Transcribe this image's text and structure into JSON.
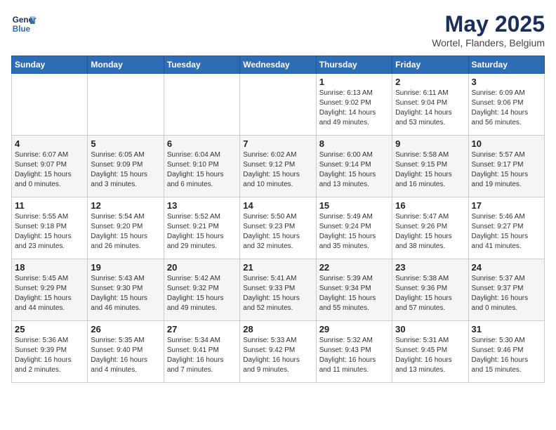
{
  "logo": {
    "line1": "General",
    "line2": "Blue"
  },
  "title": "May 2025",
  "location": "Wortel, Flanders, Belgium",
  "days_header": [
    "Sunday",
    "Monday",
    "Tuesday",
    "Wednesday",
    "Thursday",
    "Friday",
    "Saturday"
  ],
  "weeks": [
    [
      {
        "day": "",
        "info": ""
      },
      {
        "day": "",
        "info": ""
      },
      {
        "day": "",
        "info": ""
      },
      {
        "day": "",
        "info": ""
      },
      {
        "day": "1",
        "info": "Sunrise: 6:13 AM\nSunset: 9:02 PM\nDaylight: 14 hours\nand 49 minutes."
      },
      {
        "day": "2",
        "info": "Sunrise: 6:11 AM\nSunset: 9:04 PM\nDaylight: 14 hours\nand 53 minutes."
      },
      {
        "day": "3",
        "info": "Sunrise: 6:09 AM\nSunset: 9:06 PM\nDaylight: 14 hours\nand 56 minutes."
      }
    ],
    [
      {
        "day": "4",
        "info": "Sunrise: 6:07 AM\nSunset: 9:07 PM\nDaylight: 15 hours\nand 0 minutes."
      },
      {
        "day": "5",
        "info": "Sunrise: 6:05 AM\nSunset: 9:09 PM\nDaylight: 15 hours\nand 3 minutes."
      },
      {
        "day": "6",
        "info": "Sunrise: 6:04 AM\nSunset: 9:10 PM\nDaylight: 15 hours\nand 6 minutes."
      },
      {
        "day": "7",
        "info": "Sunrise: 6:02 AM\nSunset: 9:12 PM\nDaylight: 15 hours\nand 10 minutes."
      },
      {
        "day": "8",
        "info": "Sunrise: 6:00 AM\nSunset: 9:14 PM\nDaylight: 15 hours\nand 13 minutes."
      },
      {
        "day": "9",
        "info": "Sunrise: 5:58 AM\nSunset: 9:15 PM\nDaylight: 15 hours\nand 16 minutes."
      },
      {
        "day": "10",
        "info": "Sunrise: 5:57 AM\nSunset: 9:17 PM\nDaylight: 15 hours\nand 19 minutes."
      }
    ],
    [
      {
        "day": "11",
        "info": "Sunrise: 5:55 AM\nSunset: 9:18 PM\nDaylight: 15 hours\nand 23 minutes."
      },
      {
        "day": "12",
        "info": "Sunrise: 5:54 AM\nSunset: 9:20 PM\nDaylight: 15 hours\nand 26 minutes."
      },
      {
        "day": "13",
        "info": "Sunrise: 5:52 AM\nSunset: 9:21 PM\nDaylight: 15 hours\nand 29 minutes."
      },
      {
        "day": "14",
        "info": "Sunrise: 5:50 AM\nSunset: 9:23 PM\nDaylight: 15 hours\nand 32 minutes."
      },
      {
        "day": "15",
        "info": "Sunrise: 5:49 AM\nSunset: 9:24 PM\nDaylight: 15 hours\nand 35 minutes."
      },
      {
        "day": "16",
        "info": "Sunrise: 5:47 AM\nSunset: 9:26 PM\nDaylight: 15 hours\nand 38 minutes."
      },
      {
        "day": "17",
        "info": "Sunrise: 5:46 AM\nSunset: 9:27 PM\nDaylight: 15 hours\nand 41 minutes."
      }
    ],
    [
      {
        "day": "18",
        "info": "Sunrise: 5:45 AM\nSunset: 9:29 PM\nDaylight: 15 hours\nand 44 minutes."
      },
      {
        "day": "19",
        "info": "Sunrise: 5:43 AM\nSunset: 9:30 PM\nDaylight: 15 hours\nand 46 minutes."
      },
      {
        "day": "20",
        "info": "Sunrise: 5:42 AM\nSunset: 9:32 PM\nDaylight: 15 hours\nand 49 minutes."
      },
      {
        "day": "21",
        "info": "Sunrise: 5:41 AM\nSunset: 9:33 PM\nDaylight: 15 hours\nand 52 minutes."
      },
      {
        "day": "22",
        "info": "Sunrise: 5:39 AM\nSunset: 9:34 PM\nDaylight: 15 hours\nand 55 minutes."
      },
      {
        "day": "23",
        "info": "Sunrise: 5:38 AM\nSunset: 9:36 PM\nDaylight: 15 hours\nand 57 minutes."
      },
      {
        "day": "24",
        "info": "Sunrise: 5:37 AM\nSunset: 9:37 PM\nDaylight: 16 hours\nand 0 minutes."
      }
    ],
    [
      {
        "day": "25",
        "info": "Sunrise: 5:36 AM\nSunset: 9:39 PM\nDaylight: 16 hours\nand 2 minutes."
      },
      {
        "day": "26",
        "info": "Sunrise: 5:35 AM\nSunset: 9:40 PM\nDaylight: 16 hours\nand 4 minutes."
      },
      {
        "day": "27",
        "info": "Sunrise: 5:34 AM\nSunset: 9:41 PM\nDaylight: 16 hours\nand 7 minutes."
      },
      {
        "day": "28",
        "info": "Sunrise: 5:33 AM\nSunset: 9:42 PM\nDaylight: 16 hours\nand 9 minutes."
      },
      {
        "day": "29",
        "info": "Sunrise: 5:32 AM\nSunset: 9:43 PM\nDaylight: 16 hours\nand 11 minutes."
      },
      {
        "day": "30",
        "info": "Sunrise: 5:31 AM\nSunset: 9:45 PM\nDaylight: 16 hours\nand 13 minutes."
      },
      {
        "day": "31",
        "info": "Sunrise: 5:30 AM\nSunset: 9:46 PM\nDaylight: 16 hours\nand 15 minutes."
      }
    ]
  ]
}
